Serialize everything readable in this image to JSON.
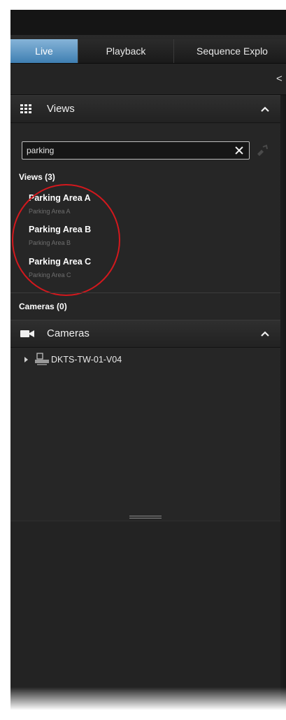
{
  "tabs": [
    {
      "label": "Live",
      "active": true
    },
    {
      "label": "Playback",
      "active": false
    },
    {
      "label": "Sequence Explo",
      "active": false
    }
  ],
  "toolbar": {
    "collapse_glyph": "<"
  },
  "views_section": {
    "title": "Views",
    "icon": "grid-icon",
    "search": {
      "value": "parking"
    },
    "views_group_label": "Views (3)",
    "views": [
      {
        "name": "Parking Area A",
        "path": "Parking Area A"
      },
      {
        "name": "Parking Area B",
        "path": "Parking Area B"
      },
      {
        "name": "Parking Area C",
        "path": "Parking Area C"
      }
    ],
    "cameras_group_label": "Cameras (0)"
  },
  "cameras_section": {
    "title": "Cameras",
    "icon": "camera-icon",
    "tree": [
      {
        "label": "DKTS-TW-01-V04",
        "icon": "server-icon"
      }
    ]
  },
  "colors": {
    "accent": "#4a8ac0",
    "highlight": "#d3181d"
  }
}
